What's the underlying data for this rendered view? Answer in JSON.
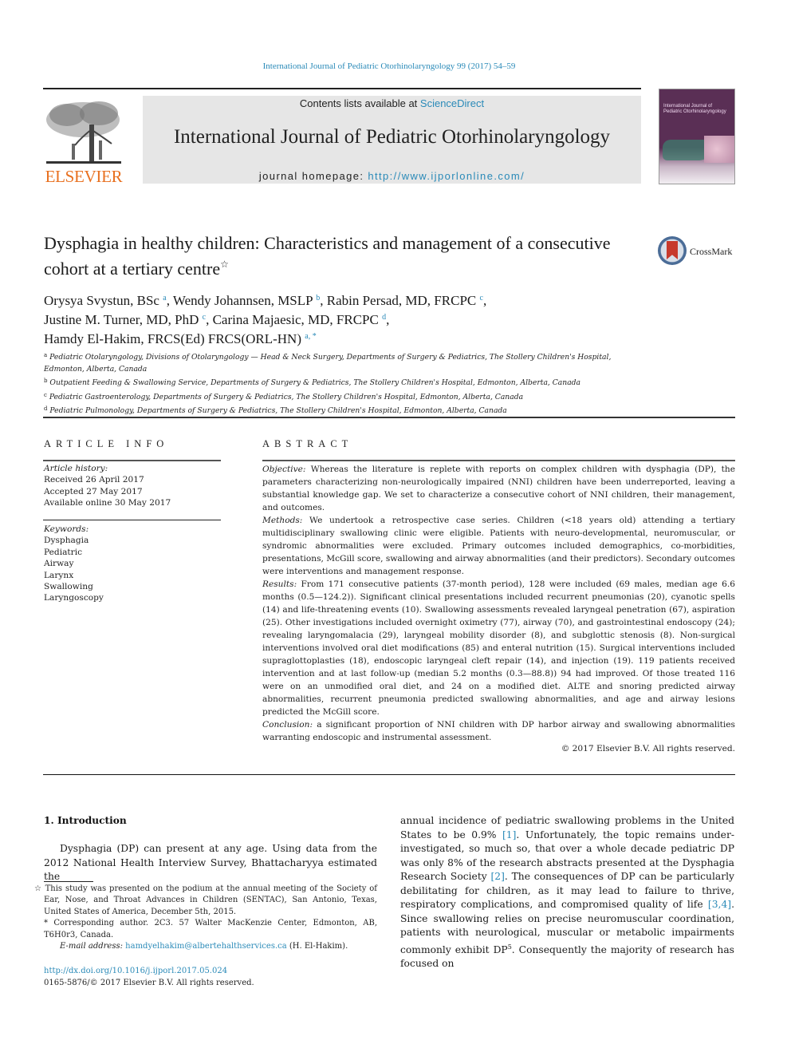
{
  "header": {
    "citation": "International Journal of Pediatric Otorhinolaryngology 99 (2017) 54–59",
    "contents_prefix": "Contents lists available at ",
    "contents_link": "ScienceDirect",
    "journal_title": "International Journal of Pediatric Otorhinolaryngology",
    "homepage_prefix": "journal homepage: ",
    "homepage_url": "http://www.ijporlonline.com/",
    "publisher_logo": "ELSEVIER",
    "cover_title_small": "International Journal of",
    "cover_title": "Pediatric Otorhinolaryngology",
    "brand_color": "#e8701f",
    "link_color": "#2a8ab8"
  },
  "article": {
    "title": "Dysphagia in healthy children: Characteristics and management of a consecutive cohort at a tertiary centre",
    "title_mark": "☆",
    "crossmark_label": "CrossMark",
    "authors": [
      {
        "name": "Orysya Svystun, BSc",
        "aff": "a",
        "sep": ", "
      },
      {
        "name": "Wendy Johannsen, MSLP",
        "aff": "b",
        "sep": ", "
      },
      {
        "name": "Rabin Persad, MD, FRCPC",
        "aff": "c",
        "sep": ","
      },
      {
        "name": "Justine M. Turner, MD, PhD",
        "aff": "c",
        "sep": ", "
      },
      {
        "name": "Carina Majaesic, MD, FRCPC",
        "aff": "d",
        "sep": ","
      },
      {
        "name": "Hamdy El-Hakim, FRCS(Ed) FRCS(ORL-HN)",
        "aff": "a, *",
        "sep": ""
      }
    ],
    "affiliations": [
      {
        "key": "a",
        "text": "Pediatric Otolaryngology, Divisions of Otolaryngology — Head & Neck Surgery, Departments of Surgery & Pediatrics, The Stollery Children's Hospital, Edmonton, Alberta, Canada"
      },
      {
        "key": "b",
        "text": "Outpatient Feeding & Swallowing Service, Departments of Surgery & Pediatrics, The Stollery Children's Hospital, Edmonton, Alberta, Canada"
      },
      {
        "key": "c",
        "text": "Pediatric Gastroenterology, Departments of Surgery & Pediatrics, The Stollery Children's Hospital, Edmonton, Alberta, Canada"
      },
      {
        "key": "d",
        "text": "Pediatric Pulmonology, Departments of Surgery & Pediatrics, The Stollery Children's Hospital, Edmonton, Alberta, Canada"
      }
    ]
  },
  "article_info": {
    "heading": "ARTICLE INFO",
    "history_label": "Article history:",
    "received": "Received 26 April 2017",
    "accepted": "Accepted 27 May 2017",
    "online": "Available online 30 May 2017",
    "keywords_label": "Keywords:",
    "keywords": [
      "Dysphagia",
      "Pediatric",
      "Airway",
      "Larynx",
      "Swallowing",
      "Laryngoscopy"
    ]
  },
  "abstract": {
    "heading": "ABSTRACT",
    "sections": [
      {
        "label": "Objective:",
        "text": " Whereas the literature is replete with reports on complex children with dysphagia (DP), the parameters characterizing non-neurologically impaired (NNI) children have been underreported, leaving a substantial knowledge gap. We set to characterize a consecutive cohort of NNI children, their management, and outcomes."
      },
      {
        "label": "Methods:",
        "text": " We undertook a retrospective case series. Children (<18 years old) attending a tertiary multidisciplinary swallowing clinic were eligible. Patients with neuro-developmental, neuromuscular, or syndromic abnormalities were excluded. Primary outcomes included demographics, co-morbidities, presentations, McGill score, swallowing and airway abnormalities (and their predictors). Secondary outcomes were interventions and management response."
      },
      {
        "label": "Results:",
        "text": " From 171 consecutive patients (37-month period), 128 were included (69 males, median age 6.6 months (0.5—124.2)). Significant clinical presentations included recurrent pneumonias (20), cyanotic spells (14) and life-threatening events (10). Swallowing assessments revealed laryngeal penetration (67), aspiration (25). Other investigations included overnight oximetry (77), airway (70), and gastrointestinal endoscopy (24); revealing laryngomalacia (29), laryngeal mobility disorder (8), and subglottic stenosis (8). Non-surgical interventions involved oral diet modifications (85) and enteral nutrition (15). Surgical interventions included supraglottoplasties (18), endoscopic laryngeal cleft repair (14), and injection (19). 119 patients received intervention and at last follow-up (median 5.2 months (0.3—88.8)) 94 had improved. Of those treated 116 were on an unmodified oral diet, and 24 on a modified diet. ALTE and snoring predicted airway abnormalities, recurrent pneumonia predicted swallowing abnormalities, and age and airway lesions predicted the McGill score."
      },
      {
        "label": "Conclusion:",
        "text": " a significant proportion of NNI children with DP harbor airway and swallowing abnormalities warranting endoscopic and instrumental assessment."
      }
    ],
    "copyright": "© 2017 Elsevier B.V. All rights reserved."
  },
  "introduction": {
    "heading": "1.  Introduction",
    "left_text": "Dysphagia (DP) can present at any age. Using data from the 2012 National Health Interview Survey, Bhattacharyya estimated the",
    "right_parts": [
      {
        "t": "annual incidence of pediatric swallowing problems in the United States to be 0.9% "
      },
      {
        "ref": "[1]"
      },
      {
        "t": ". Unfortunately, the topic remains under-investigated, so much so, that over a whole decade pediatric DP was only 8% of the research abstracts presented at the Dysphagia Research Society "
      },
      {
        "ref": "[2]"
      },
      {
        "t": ". The consequences of DP can be particularly debilitating for children, as it may lead to failure to thrive, respiratory complications, and compromised quality of life "
      },
      {
        "ref": "[3,4]"
      },
      {
        "t": ". Since swallowing relies on precise neuromuscular coordination, patients with neurological, muscular or metabolic impairments commonly exhibit DP"
      },
      {
        "sup": "5"
      },
      {
        "t": ". Consequently the majority of research has focused on"
      }
    ]
  },
  "footnotes": {
    "star": "☆ This study was presented on the podium at the annual meeting of the Society of Ear, Nose, and Throat Advances in Children (SENTAC), San Antonio, Texas, United States of America, December 5th, 2015.",
    "corresponding": "* Corresponding author. 2C3. 57 Walter MacKenzie Center, Edmonton, AB, T6H0r3, Canada.",
    "email_label": "E-mail address:",
    "email": "hamdyelhakim@albertehalthservices.ca",
    "email_suffix": " (H. El-Hakim).",
    "doi": "http://dx.doi.org/10.1016/j.ijporl.2017.05.024",
    "issn": "0165-5876/© 2017 Elsevier B.V. All rights reserved."
  }
}
